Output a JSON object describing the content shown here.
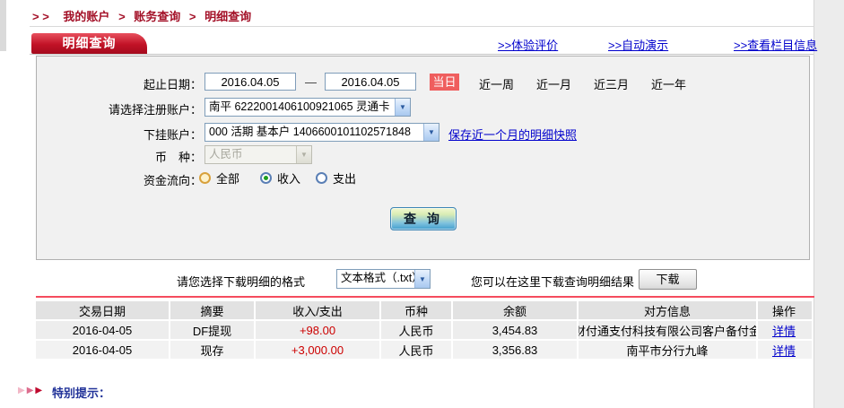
{
  "breadcrumb": {
    "prefix": "> >",
    "separator": ">",
    "items": [
      "我的账户",
      "账务查询",
      "明细查询"
    ]
  },
  "tab": {
    "title": "明细查询"
  },
  "header_links": [
    {
      "label": ">>体验评价"
    },
    {
      "label": ">>自动演示"
    },
    {
      "label": ">>查看栏目信息"
    }
  ],
  "form": {
    "date_label": "起止日期：",
    "date_from": "2016.04.05",
    "date_separator": "—",
    "date_to": "2016.04.05",
    "quick_ranges": {
      "active": "当日",
      "others": [
        "近一周",
        "近一月",
        "近三月",
        "近一年"
      ]
    },
    "register_account": {
      "label": "请选择注册账户：",
      "value": "南平 6222001406100921065 灵通卡"
    },
    "sub_account": {
      "label": "下挂账户：",
      "value": "000 活期 基本户 1406600101102571848",
      "snapshot_link": "保存近一个月的明细快照"
    },
    "currency": {
      "label": "币　种：",
      "value": "人民币"
    },
    "flow": {
      "label": "资金流向：",
      "options": [
        {
          "label": "全部",
          "selected": false
        },
        {
          "label": "收入",
          "selected": true
        },
        {
          "label": "支出",
          "selected": false
        }
      ]
    },
    "query_button": "查 询",
    "dropdown_arrow": "▼"
  },
  "download": {
    "format_label": "请您选择下载明细的格式",
    "format_value": "文本格式（.txt）",
    "hint": "您可以在这里下载查询明细结果",
    "button": "下载"
  },
  "table": {
    "headers": [
      "交易日期",
      "摘要",
      "收入/支出",
      "币种",
      "余额",
      "对方信息",
      "操作"
    ],
    "rows": [
      {
        "date": "2016-04-05",
        "summary": "DF提现",
        "amount": "+98.00",
        "currency": "人民币",
        "balance": "3,454.83",
        "counterparty": "财付通支付科技有限公司客户备付金",
        "action": "详情"
      },
      {
        "date": "2016-04-05",
        "summary": "现存",
        "amount": "+3,000.00",
        "currency": "人民币",
        "balance": "3,356.83",
        "counterparty": "南平市分行九峰",
        "action": "详情"
      }
    ]
  },
  "footer": {
    "arrow_glyph": "▶",
    "notice": "特别提示："
  },
  "colors": {
    "brand_red": "#b00d20",
    "badge_red": "#ef5e5e",
    "link_blue": "#0000cc",
    "amount_red": "#cc0000",
    "divider_red": "#f54b5e"
  }
}
